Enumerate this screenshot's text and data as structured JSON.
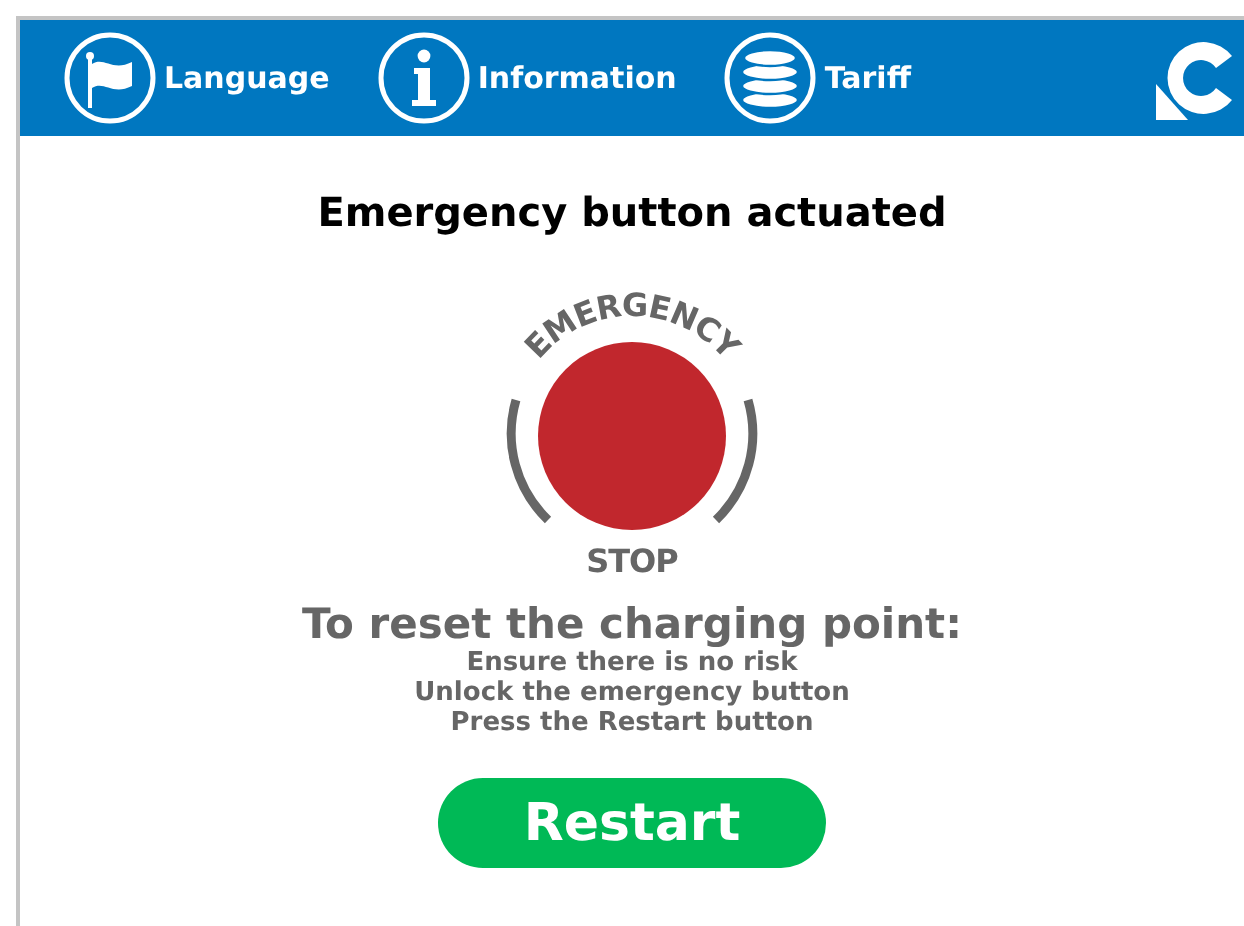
{
  "nav": [
    {
      "label": "Language"
    },
    {
      "label": "Information"
    },
    {
      "label": "Tariff"
    }
  ],
  "title": "Emergency button actuated",
  "emergency_graphic": {
    "top_text": "EMERGENCY",
    "bottom_text": "STOP"
  },
  "instructions": {
    "heading": "To reset the charging point:",
    "steps": [
      "Ensure there is no risk",
      "Unlock the emergency button",
      "Press the Restart button"
    ]
  },
  "restart_button": "Restart"
}
